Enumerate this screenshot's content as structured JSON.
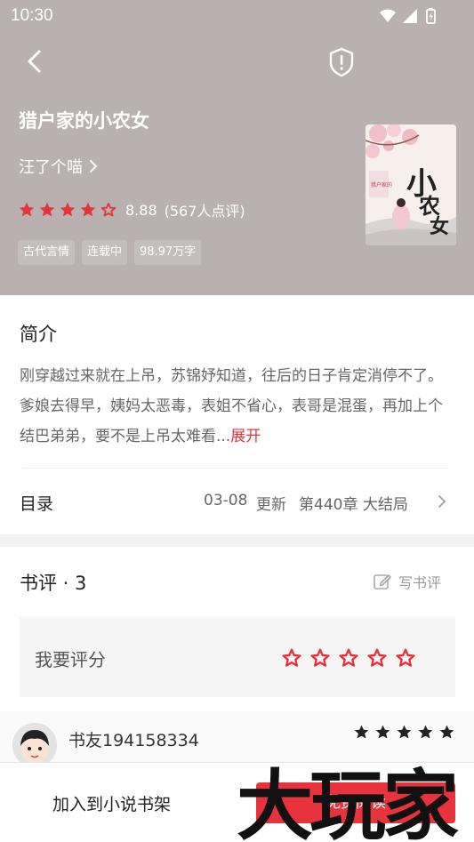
{
  "status_bar": {
    "time": "10:30"
  },
  "book": {
    "title": "猎户家的小农女",
    "author": "汪了个喵",
    "rating_score": "8.88",
    "rating_count": "(567人点评)",
    "rating_stars": 4.5,
    "tags": [
      "古代言情",
      "连载中",
      "98.97万字"
    ],
    "cover_text": [
      "小农女",
      "猎户家的"
    ]
  },
  "intro": {
    "title": "简介",
    "text": "刚穿越过来就在上吊，苏锦妤知道，往后的日子肯定消停不了。爹娘去得早，姨妈太恶毒，表姐不省心，表哥是混蛋，再加上个结巴弟弟，要不是上吊太难看...",
    "more_label": "展开"
  },
  "catalog": {
    "label": "目录",
    "date": "03-08",
    "update_label": "更新",
    "latest_chapter": "第440章 大结局"
  },
  "reviews": {
    "title": "书评 · 3",
    "write_label": "写书评",
    "rate_label": "我要评分",
    "items": [
      {
        "name": "书友194158334",
        "stars": 5
      }
    ]
  },
  "bottom": {
    "add_shelf_label": "加入到小说书架",
    "read_label": "免费阅读"
  },
  "watermark": "大玩家",
  "colors": {
    "header_bg": "#b8b1b0",
    "accent": "#e8323c",
    "star": "#e8323c"
  }
}
